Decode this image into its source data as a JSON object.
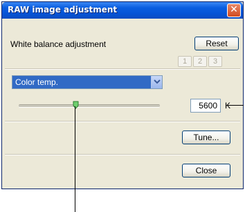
{
  "window": {
    "title": "RAW image adjustment",
    "close_glyph": "✕"
  },
  "white_balance": {
    "label": "White balance adjustment",
    "reset_label": "Reset",
    "slot_buttons": [
      "1",
      "2",
      "3"
    ]
  },
  "mode_select": {
    "value": "Color temp."
  },
  "color_temp": {
    "slider_fraction": 0.4,
    "value": "5600",
    "unit": "K"
  },
  "buttons": {
    "tune_label": "Tune...",
    "close_label": "Close"
  },
  "colors": {
    "title_bar": "#0a5ee0",
    "selection": "#316ac5",
    "slider_thumb": "#4caf50",
    "dialog_bg": "#ece9d8"
  },
  "icons": {
    "window_close": "close-icon",
    "dropdown": "chevron-down-icon",
    "slider": "slider-thumb-icon"
  }
}
